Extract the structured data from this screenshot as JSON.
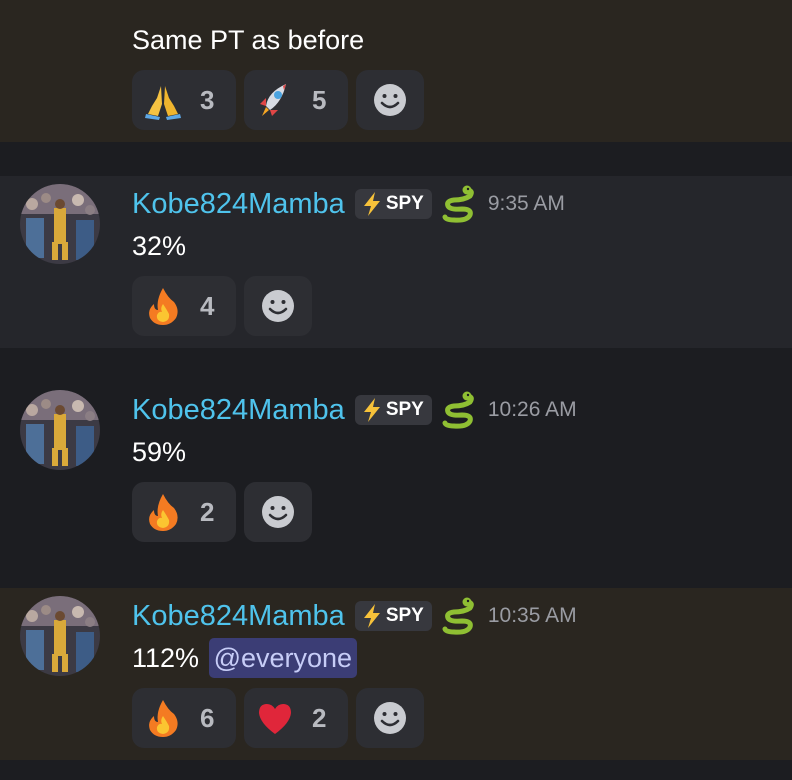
{
  "messages": [
    {
      "id": "m0",
      "continuation": true,
      "content": "Same PT as before",
      "reactions": [
        {
          "emoji": "folded-hands",
          "count": "3"
        },
        {
          "emoji": "rocket",
          "count": "5"
        }
      ]
    },
    {
      "id": "m1",
      "username": "Kobe824Mamba",
      "role": "SPY",
      "time": "9:35 AM",
      "content": "32%",
      "reactions": [
        {
          "emoji": "fire",
          "count": "4"
        }
      ]
    },
    {
      "id": "m2",
      "username": "Kobe824Mamba",
      "role": "SPY",
      "time": "10:26 AM",
      "content": "59%",
      "reactions": [
        {
          "emoji": "fire",
          "count": "2"
        }
      ]
    },
    {
      "id": "m3",
      "username": "Kobe824Mamba",
      "role": "SPY",
      "time": "10:35 AM",
      "content": "112%",
      "mention": "@everyone",
      "reactions": [
        {
          "emoji": "fire",
          "count": "6"
        },
        {
          "emoji": "red-heart",
          "count": "2"
        }
      ]
    }
  ],
  "colors": {
    "background": "#1c1d21",
    "mention_highlight": "#2a2620",
    "hover_highlight": "#25262b",
    "username": "#4fc3ec",
    "mention_pill": "#3b3d75",
    "reaction_bg": "#2d2e33",
    "timestamp": "#9a9ca3"
  },
  "icons": {
    "role_icon": "lightning-bolt-icon",
    "badge_icon": "snake-icon",
    "add_reaction_icon": "smiley-face-icon"
  }
}
